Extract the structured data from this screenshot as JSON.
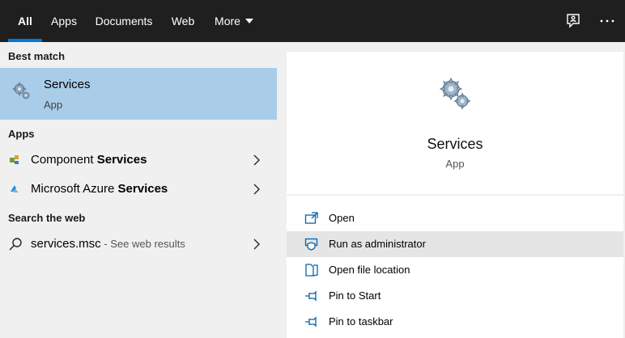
{
  "topbar": {
    "tabs": [
      {
        "label": "All",
        "active": true
      },
      {
        "label": "Apps"
      },
      {
        "label": "Documents"
      },
      {
        "label": "Web"
      },
      {
        "label": "More"
      }
    ],
    "icons": [
      "feedback-icon",
      "more-options-icon"
    ]
  },
  "left": {
    "best_match_header": "Best match",
    "best_match": {
      "title": "Services",
      "subtitle": "App",
      "icon": "services-gears-icon"
    },
    "apps_header": "Apps",
    "apps": [
      {
        "prefix": "Component ",
        "bold": "Services",
        "icon": "component-services-icon"
      },
      {
        "prefix": "Microsoft Azure ",
        "bold": "Services",
        "icon": "azure-services-icon"
      }
    ],
    "web_header": "Search the web",
    "web_result": {
      "query": "services.msc",
      "hint": " - See web results",
      "icon": "search-icon"
    }
  },
  "right": {
    "title": "Services",
    "subtitle": "App",
    "actions": [
      {
        "label": "Open",
        "icon": "open-icon"
      },
      {
        "label": "Run as administrator",
        "icon": "shield-icon"
      },
      {
        "label": "Open file location",
        "icon": "file-location-icon"
      },
      {
        "label": "Pin to Start",
        "icon": "pin-icon"
      },
      {
        "label": "Pin to taskbar",
        "icon": "pin-icon"
      }
    ]
  },
  "colors": {
    "topbar_bg": "#1f1f1f",
    "accent": "#0078d7",
    "selected_bg": "#a9cce9",
    "pane_bg": "#f0f0f0",
    "hover_bg": "#e5e5e5"
  }
}
